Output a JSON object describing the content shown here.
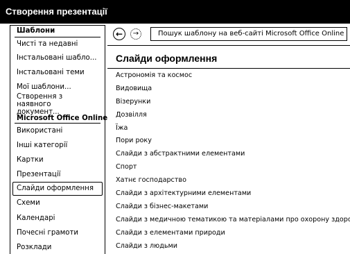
{
  "window": {
    "title": "Створення презентації"
  },
  "sidebar": {
    "items": [
      {
        "label": "Шаблони",
        "kind": "heading"
      },
      {
        "label": "Чисті та недавні",
        "kind": "item"
      },
      {
        "label": "Інстальовані шабло...",
        "kind": "item"
      },
      {
        "label": "Інстальовані теми",
        "kind": "item"
      },
      {
        "label": "Мої шаблони...",
        "kind": "item"
      },
      {
        "label": "Створення з наявного документ...",
        "kind": "item-two"
      },
      {
        "label": "Microsoft Office Online",
        "kind": "bold"
      },
      {
        "label": "Використані",
        "kind": "item"
      },
      {
        "label": "Інші категорії",
        "kind": "item"
      },
      {
        "label": "Картки",
        "kind": "item"
      },
      {
        "label": "Презентації",
        "kind": "item"
      },
      {
        "label": "Слайди оформлення",
        "kind": "selected"
      },
      {
        "label": "Схеми",
        "kind": "item"
      },
      {
        "label": "Календарі",
        "kind": "item"
      },
      {
        "label": "Почесні грамоти",
        "kind": "item"
      },
      {
        "label": "Розклади",
        "kind": "item"
      }
    ]
  },
  "nav": {
    "back_icon": "back-arrow-icon",
    "forward_icon": "forward-arrow-icon",
    "search_placeholder": "Пошук шаблону на веб-сайті Microsoft Office Online"
  },
  "main": {
    "section_title": "Слайди оформлення",
    "items": [
      "Астрономія та космос",
      "Видовища",
      "Візерунки",
      "Дозвілля",
      "Їжа",
      "Пори року",
      "Слайди з абстрактними елементами",
      "Спорт",
      "Хатнє господарство",
      "Слайди з архітектурними елементами",
      "Слайди з бізнес-макетами",
      "Слайди з медичною тематикою та матеріалами про охорону здоров'я",
      "Слайди з елементами природи",
      "Слайди з людьми"
    ]
  }
}
